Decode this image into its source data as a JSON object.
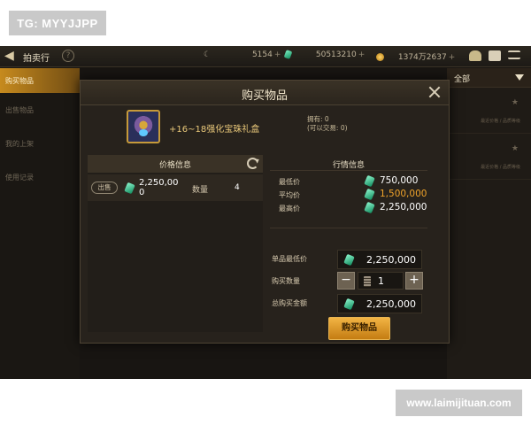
{
  "watermarks": {
    "top": "TG: MYYJJPP",
    "bottom": "www.laimijituan.com"
  },
  "topbar": {
    "title": "拍卖行",
    "currency": [
      {
        "icon": "moon-icon",
        "value": "5154"
      },
      {
        "icon": "gem-icon",
        "value": "50513210"
      },
      {
        "icon": "gold-coin-icon",
        "value": "1374万2637"
      }
    ]
  },
  "sidebar": {
    "items": [
      {
        "label": "购买物品",
        "active": true
      },
      {
        "label": "出售物品",
        "active": false
      },
      {
        "label": "我的上架",
        "active": false
      },
      {
        "label": "使用记录",
        "active": false
      }
    ]
  },
  "right_panel": {
    "filter_label": "全部",
    "card_tags": [
      "最近价格 / 品质等级",
      "最近价格 / 品质等级"
    ]
  },
  "modal": {
    "title": "购买物品",
    "item": {
      "name": "+16~18强化宝珠礼盒",
      "owned_line": "拥有: 0",
      "tradable_line": "(可以交易: 0)"
    },
    "price_panel": {
      "header": "价格信息",
      "listings": [
        {
          "tag": "出售",
          "price": "2,250,000",
          "qty_label": "数量",
          "qty": "4"
        }
      ]
    },
    "market": {
      "header": "行情信息",
      "rows": [
        {
          "label": "最低价",
          "value": "750,000",
          "color": "#ffffff"
        },
        {
          "label": "平均价",
          "value": "1,500,000",
          "color": "#f0a32a"
        },
        {
          "label": "最高价",
          "value": "2,250,000",
          "color": "#ffffff"
        }
      ]
    },
    "form": {
      "unit_min_label": "单品最低价",
      "unit_min_value": "2,250,000",
      "qty_label": "购买数量",
      "qty_value": "1",
      "minus": "−",
      "plus": "+",
      "total_label": "总购买金额",
      "total_value": "2,250,000"
    },
    "buy_button": "购买物品"
  }
}
